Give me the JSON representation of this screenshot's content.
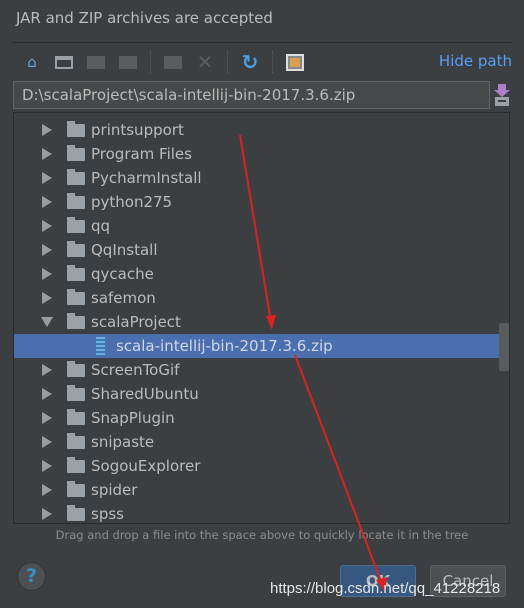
{
  "title": "JAR and ZIP archives are accepted",
  "toolbar": {
    "icons": [
      "home-icon",
      "desktop-icon",
      "new-folder-icon",
      "show-hidden-icon",
      "delete-folder-icon",
      "delete-icon",
      "refresh-icon",
      "show-path-icon"
    ],
    "hide_path": "Hide path"
  },
  "path_value": "D:\\scalaProject\\scala-intellij-bin-2017.3.6.zip",
  "tree": [
    {
      "label": "printsupport",
      "type": "folder",
      "state": "collapsed"
    },
    {
      "label": "Program Files",
      "type": "folder",
      "state": "collapsed"
    },
    {
      "label": "PycharmInstall",
      "type": "folder",
      "state": "collapsed"
    },
    {
      "label": "python275",
      "type": "folder",
      "state": "collapsed"
    },
    {
      "label": "qq",
      "type": "folder",
      "state": "collapsed"
    },
    {
      "label": "QqInstall",
      "type": "folder",
      "state": "collapsed"
    },
    {
      "label": "qycache",
      "type": "folder",
      "state": "collapsed"
    },
    {
      "label": "safemon",
      "type": "folder",
      "state": "collapsed"
    },
    {
      "label": "scalaProject",
      "type": "folder",
      "state": "expanded"
    },
    {
      "label": "scala-intellij-bin-2017.3.6.zip",
      "type": "zip",
      "state": "selected"
    },
    {
      "label": "ScreenToGif",
      "type": "folder",
      "state": "collapsed"
    },
    {
      "label": "SharedUbuntu",
      "type": "folder",
      "state": "collapsed"
    },
    {
      "label": "SnapPlugin",
      "type": "folder",
      "state": "collapsed"
    },
    {
      "label": "snipaste",
      "type": "folder",
      "state": "collapsed"
    },
    {
      "label": "SogouExplorer",
      "type": "folder",
      "state": "collapsed"
    },
    {
      "label": "spider",
      "type": "folder",
      "state": "collapsed"
    },
    {
      "label": "spss",
      "type": "folder",
      "state": "collapsed"
    }
  ],
  "hint": "Drag and drop a file into the space above to quickly locate it in the tree",
  "help": "?",
  "ok": "OK",
  "cancel": "Cancel",
  "watermark": "https://blog.csdn.net/qq_41228218",
  "colors": {
    "background": "#3c3f41",
    "selection": "#4b6eaf",
    "link": "#589df6",
    "annotation": "#e02020"
  }
}
